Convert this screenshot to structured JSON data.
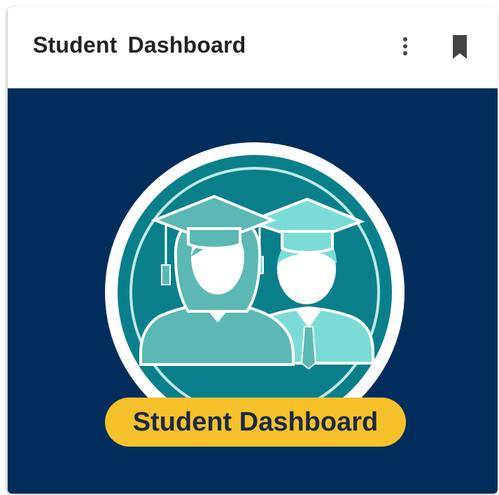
{
  "card": {
    "title": "Student Dashboard",
    "image_label": "Student Dashboard"
  },
  "icons": {
    "more": "more-vertical-icon",
    "bookmark": "bookmark-icon",
    "graduates": "graduates-icon"
  },
  "colors": {
    "hero_background": "#002d5c",
    "label_pill": "#f7c12c",
    "emblem_teal": "#0a7f8c",
    "female_figure": "#5cb8b5",
    "male_figure": "#7bdcd7",
    "icon_gray": "#444444"
  }
}
